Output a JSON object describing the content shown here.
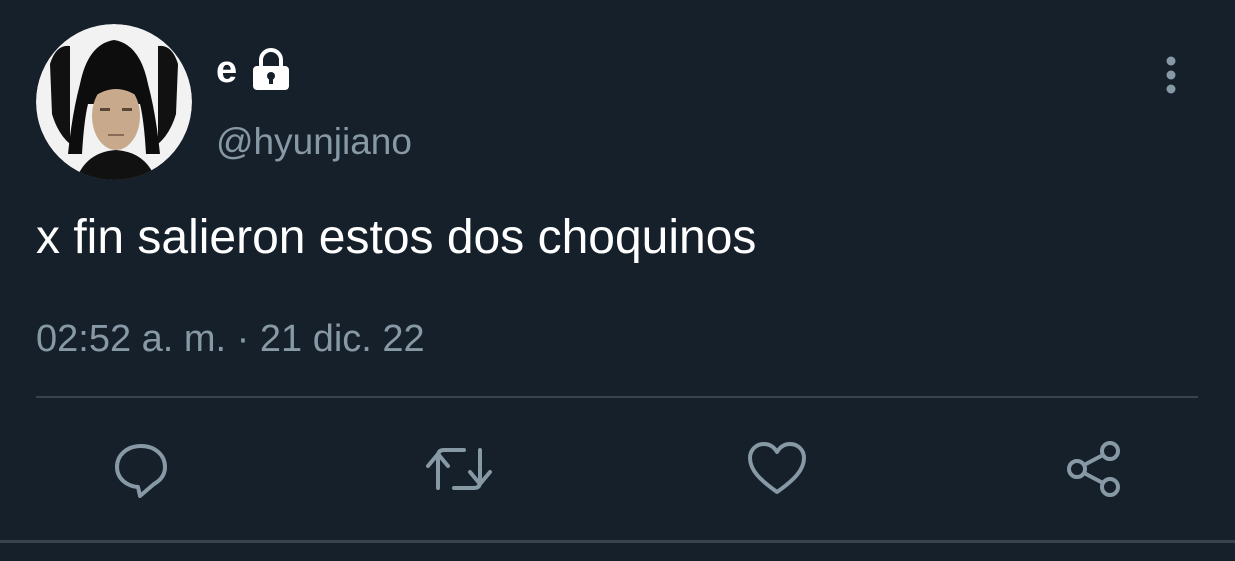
{
  "tweet": {
    "display_name": "e",
    "handle": "@hyunjiano",
    "text": "x fin salieron estos dos choquinos",
    "timestamp": "02:52 a. m. · 21 dic. 22",
    "protected": true
  },
  "icons": {
    "lock": "lock-icon",
    "more": "more-vertical-icon",
    "reply": "reply-icon",
    "retweet": "retweet-icon",
    "like": "heart-icon",
    "share": "share-icon"
  },
  "colors": {
    "background": "#15202b",
    "primary_text": "#ffffff",
    "secondary_text": "#8899a6",
    "divider": "#38444d",
    "icon": "#8899a6"
  }
}
